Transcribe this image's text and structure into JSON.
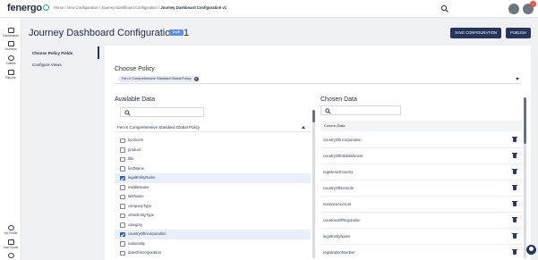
{
  "app": {
    "logo": "fenergo"
  },
  "breadcrumb": {
    "path": "Home / View Configuration / Journey Dashboard Configuration / ",
    "current": "Journey Dashboard Configuration v1"
  },
  "topbar": {
    "notification_count": "3"
  },
  "leftnav": {
    "top_items": [
      {
        "label": "Dashboards",
        "icon": "dashboard-icon"
      },
      {
        "label": "Journeys",
        "icon": "folder-icon"
      },
      {
        "label": "Entities",
        "icon": "person-icon"
      },
      {
        "label": "Reports",
        "icon": "bar-chart-icon"
      }
    ],
    "bottom_items": [
      {
        "label": "My Profile",
        "icon": "profile-icon"
      },
      {
        "label": "User Guide",
        "icon": "book-icon"
      },
      {
        "label": "",
        "icon": "settings-icon"
      }
    ]
  },
  "header": {
    "title": "Journey Dashboard Configuration v1",
    "status_badge": "Draft",
    "save_label": "SAVE CONFIGURATION",
    "publish_label": "PUBLISH"
  },
  "steps": [
    {
      "label": "Choose Policy Fields",
      "active": true
    },
    {
      "label": "Configure Views",
      "active": false
    }
  ],
  "policy": {
    "label": "Choose Policy",
    "selected": "Fen-X Comprehensive Standard Global Policy"
  },
  "available": {
    "label": "Available Data",
    "search_placeholder": "",
    "group_title": "Fen-X Comprehensive Standard Global Policy",
    "fields": [
      {
        "label": "kycScore",
        "checked": false
      },
      {
        "label": "product",
        "checked": false
      },
      {
        "label": "title",
        "checked": false
      },
      {
        "label": "firstName",
        "checked": false
      },
      {
        "label": "legalEntityName",
        "checked": true
      },
      {
        "label": "middleName",
        "checked": false
      },
      {
        "label": "lastName",
        "checked": false
      },
      {
        "label": "companyType",
        "checked": false
      },
      {
        "label": "otherEntityType",
        "checked": false
      },
      {
        "label": "category",
        "checked": false
      },
      {
        "label": "countryOfIncorporation",
        "checked": true
      },
      {
        "label": "nationality",
        "checked": false
      },
      {
        "label": "dateOfIncorporation",
        "checked": false
      }
    ]
  },
  "chosen": {
    "label": "Chosen Data",
    "search_placeholder": "",
    "column_header": "Column Data",
    "items": [
      "countryOfIncorporation",
      "countryOfEstablishment",
      "registeredCountry",
      "countryOfDomicile",
      "nomineeAccount",
      "countriesOfRegulation",
      "legalEntityName",
      "registrationNumber"
    ]
  },
  "colors": {
    "primary": "#24345a",
    "accent": "#19b394",
    "badge": "#5d8fe3",
    "selected_row": "#e9f0fb"
  }
}
